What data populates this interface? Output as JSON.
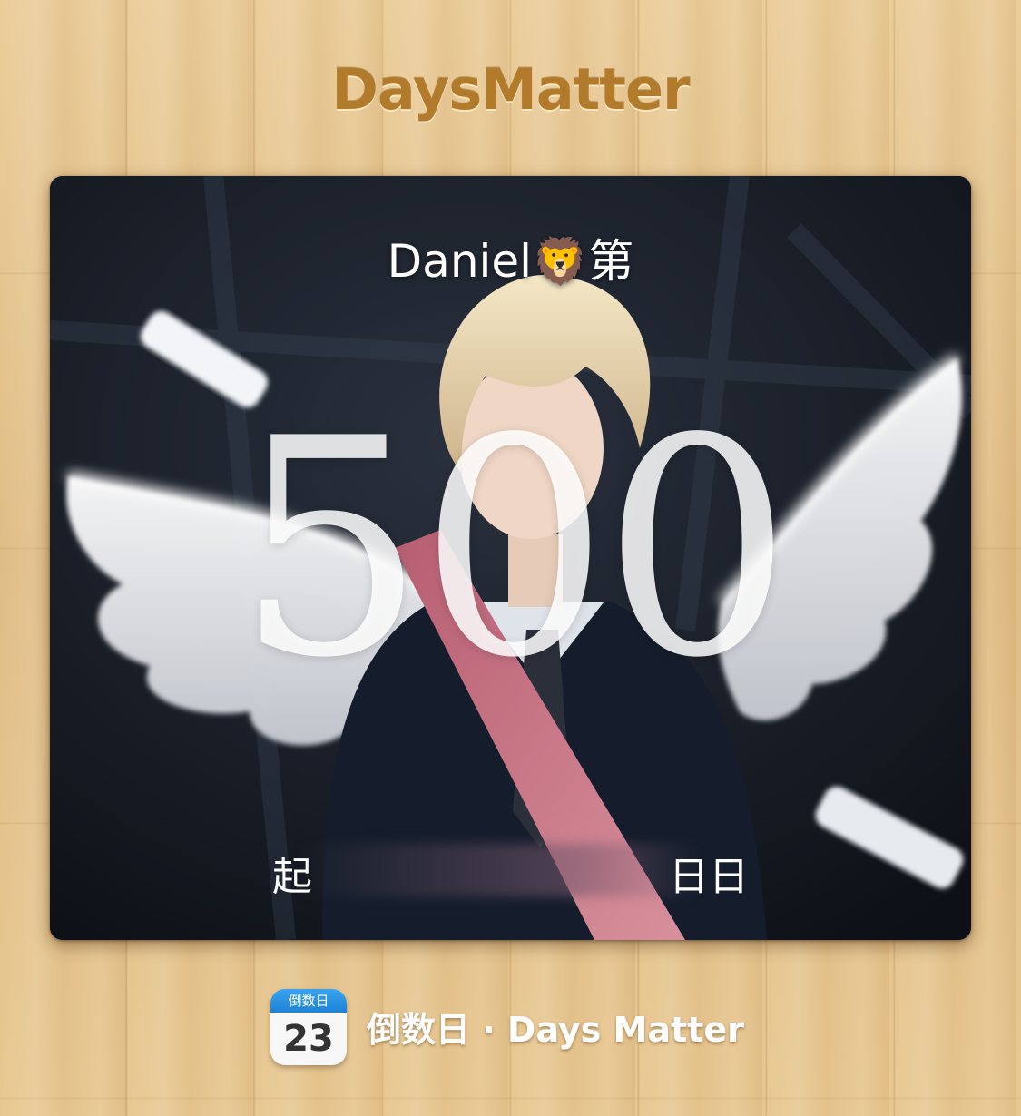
{
  "app": {
    "title": "DaysMatter"
  },
  "event": {
    "title": "Daniel🦁第",
    "day_count": "500",
    "date_line_start": "起",
    "date_line_end": "日日"
  },
  "footer": {
    "icon_top": "倒数日",
    "icon_day": "23",
    "label": "倒数日 · Days Matter"
  },
  "colors": {
    "wood": "#e4c490",
    "title_brown": "#b27b2c",
    "calendar_blue": "#2a93e4",
    "sash_pink": "#c9707f"
  }
}
